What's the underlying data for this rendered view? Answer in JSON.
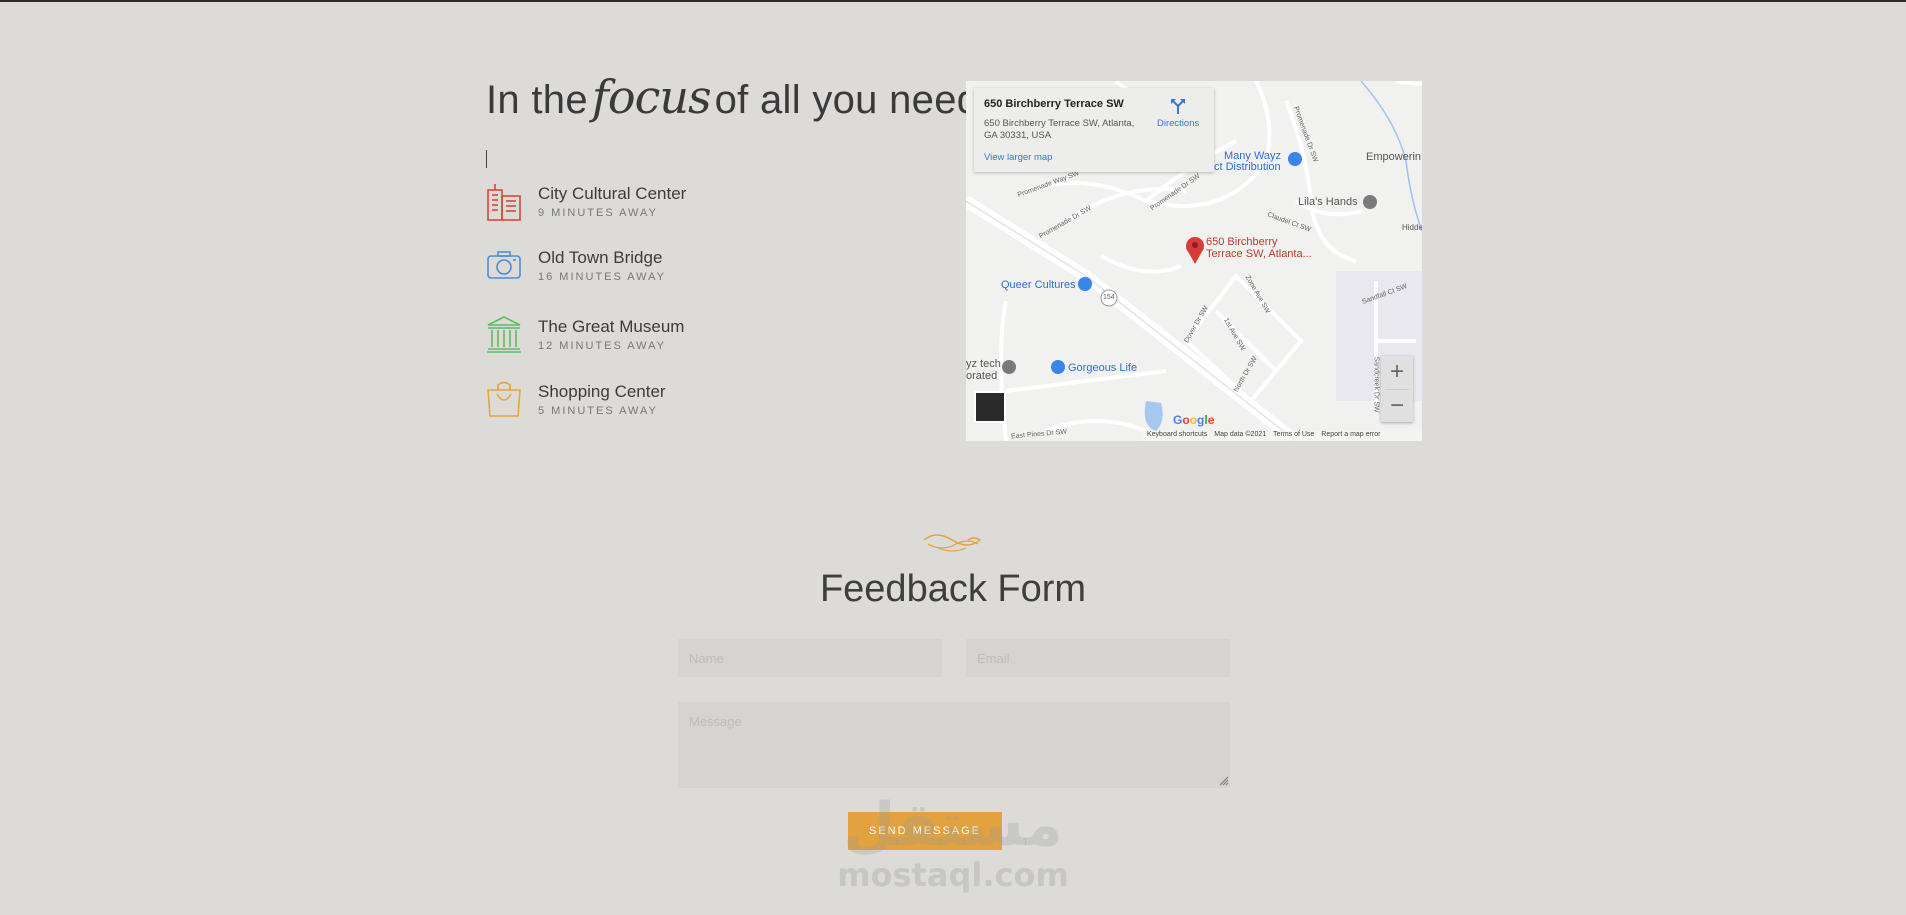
{
  "location": {
    "title_prefix": "In the",
    "title_focus": "focus",
    "title_suffix": "of all you need",
    "places": [
      {
        "icon": "building-icon",
        "name": "City Cultural Center",
        "distance": "9 MINUTES AWAY",
        "color": "#d9473a"
      },
      {
        "icon": "camera-icon",
        "name": "Old Town Bridge",
        "distance": "16 MINUTES AWAY",
        "color": "#4a8fd6"
      },
      {
        "icon": "museum-icon",
        "name": "The Great Museum",
        "distance": "12 MINUTES AWAY",
        "color": "#5dbb5d"
      },
      {
        "icon": "shopping-bag-icon",
        "name": "Shopping Center",
        "distance": "5 MINUTES AWAY",
        "color": "#e2a83a"
      }
    ]
  },
  "map": {
    "card": {
      "title": "650 Birchberry Terrace SW",
      "address": "650 Birchberry Terrace SW, Atlanta, GA 30331, USA",
      "directions": "Directions",
      "larger_map": "View larger map"
    },
    "pin_label_line1": "650 Birchberry",
    "pin_label_line2": "Terrace SW, Atlanta...",
    "pois": {
      "many_wayz": "Many Wayz",
      "distribution": "ct Distribution",
      "empowerin": "Empowerin",
      "lilas_hands": "Lila's Hands",
      "hidden": "Hidde",
      "queer_cultures": "Queer Cultures",
      "gorgeous_life": "Gorgeous Life",
      "wayz_tech_1": "yz tech",
      "wayz_tech_2": "orated"
    },
    "streets": {
      "promenade_way": "Promenade Way SW",
      "promenade_dr_1": "Promenade Dr SW",
      "promenade_dr_2": "Promenade Dr SW",
      "promenade_dr_3": "Promenade Dr SW",
      "claudel": "Claudel Ct SW",
      "zone_ave": "Zone Ave SW",
      "first_ave": "1st Ave SW",
      "dover": "Dover Dr SW",
      "north": "North Dr SW",
      "sandfall": "Sandfall Ct SW",
      "sandcreek": "Sandcreek Dr SW",
      "east_pines": "East Pines Dr SW",
      "route": "154"
    },
    "google": "Google",
    "footer": {
      "shortcuts": "Keyboard shortcuts",
      "data": "Map data ©2021",
      "terms": "Terms of Use",
      "report": "Report a map error"
    },
    "zoom_in": "+",
    "zoom_out": "−"
  },
  "feedback": {
    "title": "Feedback Form",
    "name_placeholder": "Name",
    "email_placeholder": "Email",
    "message_placeholder": "Message",
    "send_label": "SEND MESSAGE",
    "accent_color": "#e2a23f"
  },
  "watermark": {
    "arabic": "مستقل",
    "latin": "mostaql.com"
  }
}
